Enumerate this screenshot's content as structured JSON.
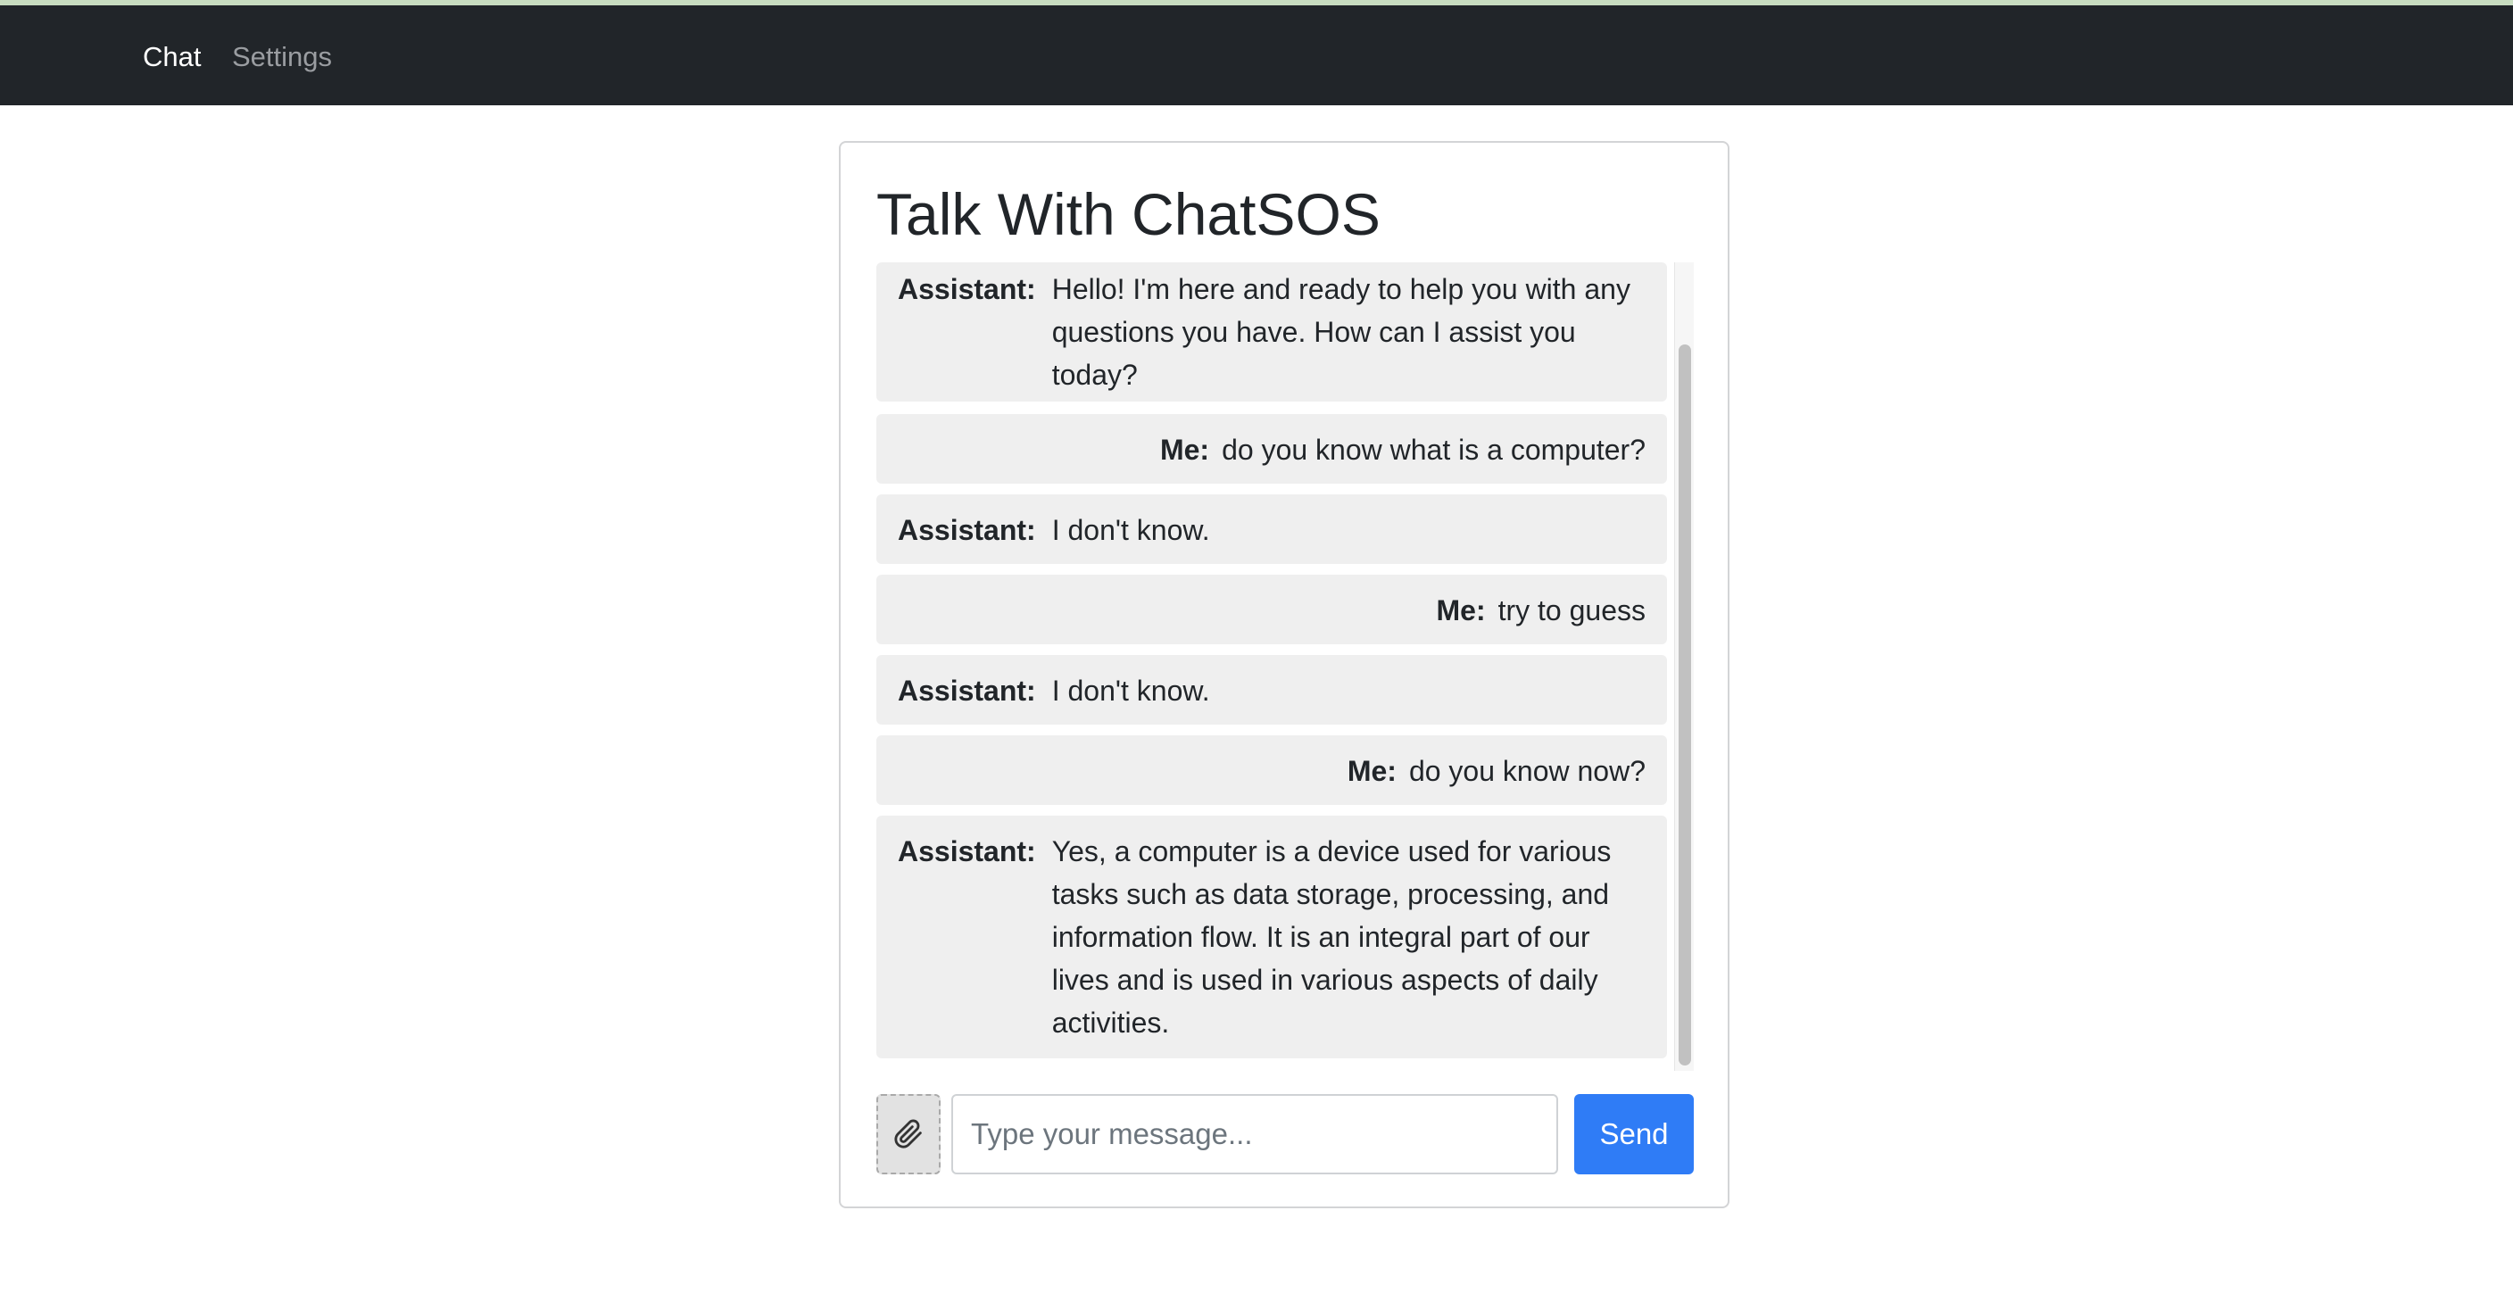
{
  "nav": {
    "links": [
      {
        "label": "Chat",
        "active": true
      },
      {
        "label": "Settings",
        "active": false
      }
    ]
  },
  "chat": {
    "title": "Talk With ChatSOS",
    "messages": [
      {
        "role": "assistant",
        "speaker": "Assistant:",
        "text": "Hello! I'm here and ready to help you with any questions you have. How can I assist you today?"
      },
      {
        "role": "me",
        "speaker": "Me:",
        "text": "do you know what is a computer?"
      },
      {
        "role": "assistant",
        "speaker": "Assistant:",
        "text": "I don't know."
      },
      {
        "role": "me",
        "speaker": "Me:",
        "text": "try to guess"
      },
      {
        "role": "assistant",
        "speaker": "Assistant:",
        "text": "I don't know."
      },
      {
        "role": "me",
        "speaker": "Me:",
        "text": "do you know now?"
      },
      {
        "role": "assistant",
        "speaker": "Assistant:",
        "text": "Yes, a computer is a device used for various tasks such as data storage, processing, and information flow. It is an integral part of our lives and is used in various aspects of daily activities."
      }
    ]
  },
  "composer": {
    "attach_icon": "paperclip-icon",
    "placeholder": "Type your message...",
    "value": "",
    "send_label": "Send"
  },
  "colors": {
    "navbar": "#212529",
    "message_bg": "#efefef",
    "send_button": "#2f7cf6"
  }
}
